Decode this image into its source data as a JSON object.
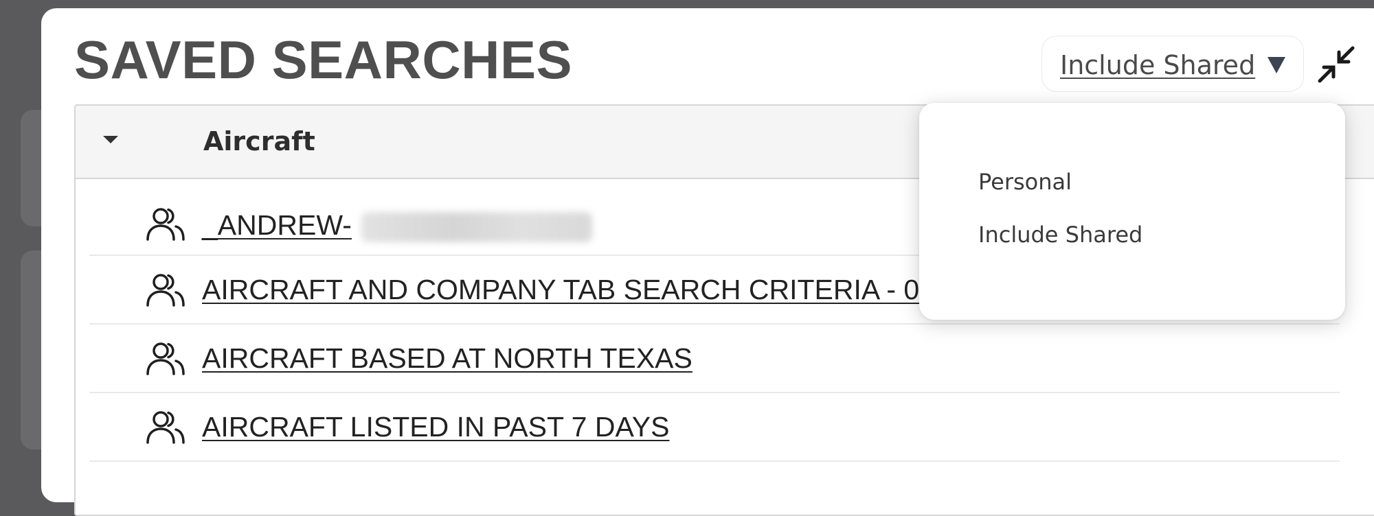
{
  "page": {
    "title": "SAVED SEARCHES"
  },
  "scope_select": {
    "selected": "Include Shared",
    "options": [
      "Personal",
      "Include Shared"
    ]
  },
  "group": {
    "title": "Aircraft",
    "items": [
      {
        "label": "_ANDREW-",
        "icon": "users-icon"
      },
      {
        "label": "AIRCRAFT AND COMPANY TAB SEARCH CRITERIA - 06/3AA",
        "icon": "users-icon"
      },
      {
        "label": "AIRCRAFT BASED AT NORTH TEXAS",
        "icon": "users-icon"
      },
      {
        "label": "AIRCRAFT LISTED IN PAST 7 DAYS",
        "icon": "users-icon"
      }
    ]
  },
  "colors": {
    "title": "#4f4f4f",
    "header_bg": "#f5f5f5",
    "backdrop": "#5a5a5c"
  }
}
